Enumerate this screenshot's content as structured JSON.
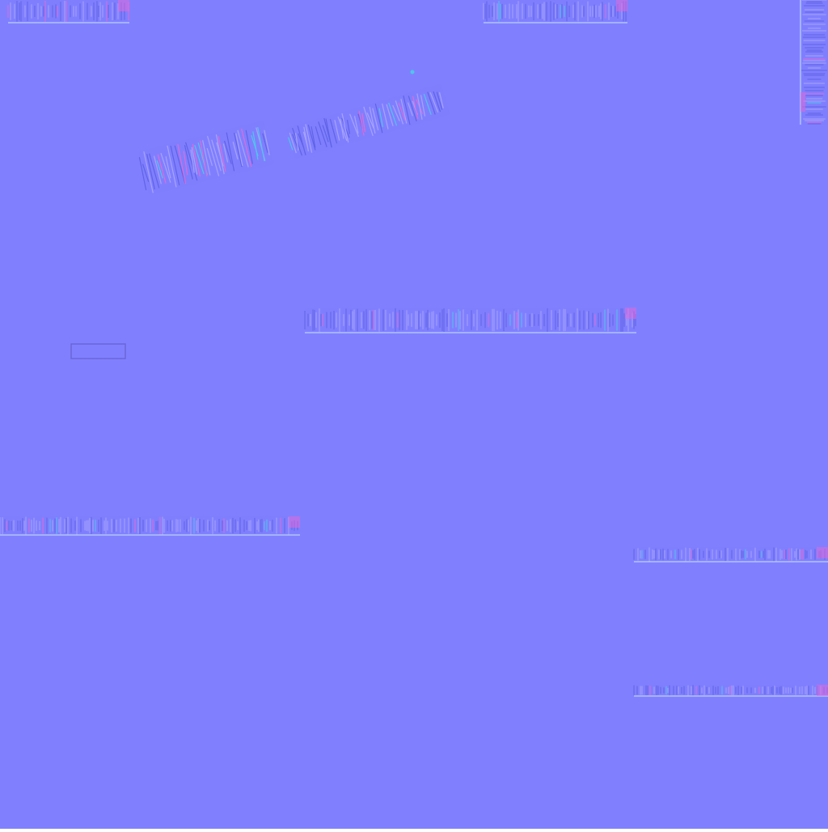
{
  "texture": {
    "type": "normal-map",
    "colors": {
      "base": "#8080FF",
      "strip_fill": "#7F7FFE",
      "stroke_light": "#A7A3FF",
      "stroke_dark": "#5F63E6",
      "accent_pink": "#E06AD9",
      "accent_cyan": "#4FC6E9",
      "edge_line": "#C8E6FF",
      "frame_line": "#6A66D8"
    }
  }
}
